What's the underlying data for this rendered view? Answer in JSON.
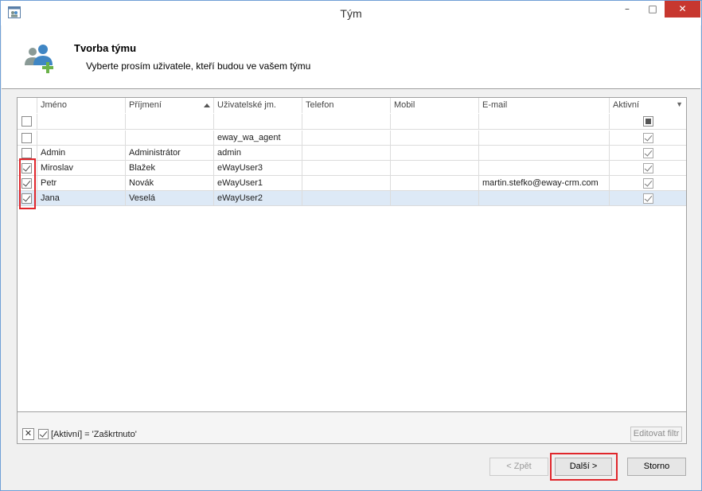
{
  "window": {
    "title": "Tým",
    "controls": {
      "minimize": "–",
      "maximize": "□",
      "close": "✕"
    }
  },
  "header": {
    "title": "Tvorba týmu",
    "subtitle": "Vyberte prosím uživatele, kteří budou ve vašem týmu"
  },
  "grid": {
    "columns": [
      "Jméno",
      "Příjmení",
      "Uživatelské jm.",
      "Telefon",
      "Mobil",
      "E-mail",
      "Aktivní"
    ],
    "sorted_column": "Příjmení",
    "filter_row": {
      "select_all": "unchecked",
      "active": "indeterminate"
    },
    "rows": [
      {
        "selected": false,
        "first_name": "",
        "last_name": "",
        "username": "eway_wa_agent",
        "phone": "",
        "mobile": "",
        "email": "",
        "active": true
      },
      {
        "selected": false,
        "first_name": "Admin",
        "last_name": "Administrátor",
        "username": "admin",
        "phone": "",
        "mobile": "",
        "email": "",
        "active": true
      },
      {
        "selected": true,
        "first_name": "Miroslav",
        "last_name": "Blažek",
        "username": "eWayUser3",
        "phone": "",
        "mobile": "",
        "email": "",
        "active": true
      },
      {
        "selected": true,
        "first_name": "Petr",
        "last_name": "Novák",
        "username": "eWayUser1",
        "phone": "",
        "mobile": "",
        "email": "martin.stefko@eway-crm.com",
        "active": true
      },
      {
        "selected": true,
        "first_name": "Jana",
        "last_name": "Veselá",
        "username": "eWayUser2",
        "phone": "",
        "mobile": "",
        "email": "",
        "active": true
      }
    ]
  },
  "filterbar": {
    "clear": "✕",
    "expression": "[Aktivní] = 'Zaškrtnuto'",
    "edit_label": "Editovat filtr"
  },
  "buttons": {
    "back": "< Zpět",
    "next": "Další >",
    "cancel": "Storno"
  },
  "colors": {
    "highlight": "#e0262b",
    "selected_row": "#dde9f6",
    "close_button": "#c7372f"
  }
}
